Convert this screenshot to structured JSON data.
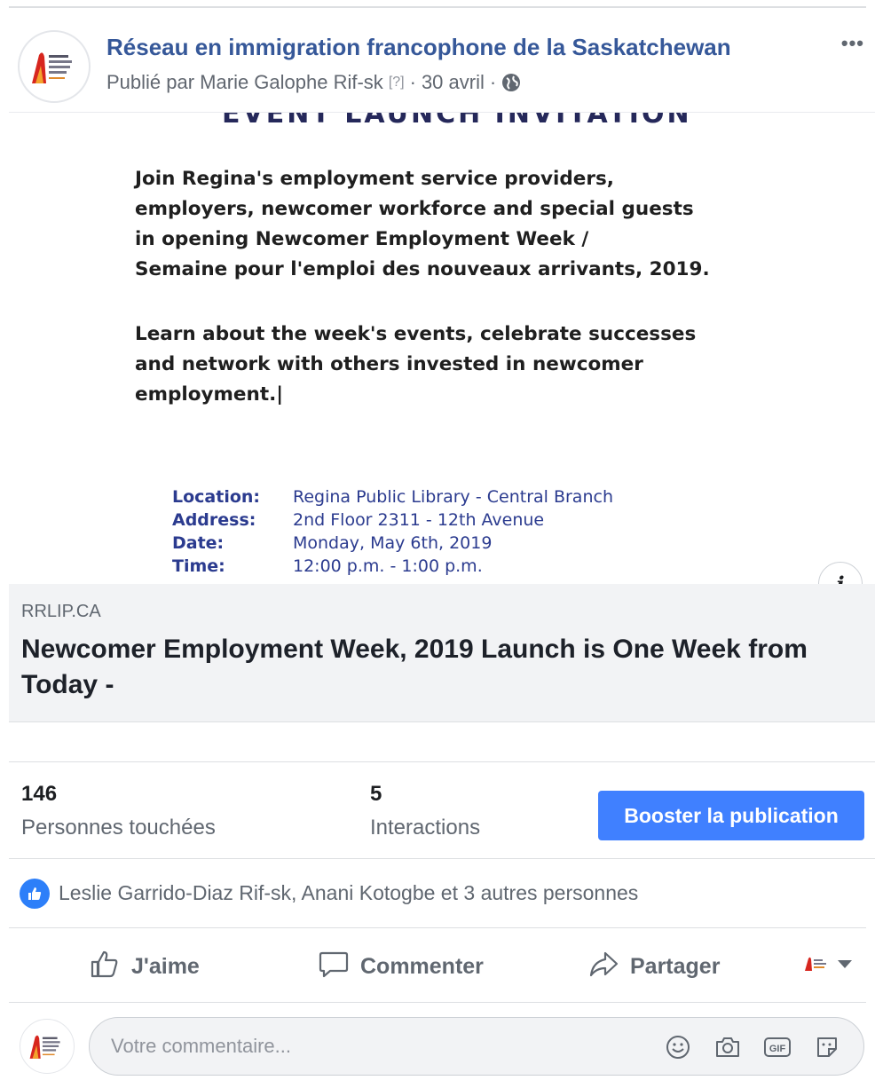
{
  "colors": {
    "link_blue": "#365899",
    "boost_blue": "#4080ff",
    "like_blue": "#2d7ff9",
    "muted_text": "#606770",
    "border": "#dddfe2",
    "preview_bg": "#f2f3f5"
  },
  "post": {
    "page_name": "Réseau en immigration francophone de la Saskatchewan",
    "published_by": "Publié par Marie Galophe Rif-sk",
    "help_marker": "[?]",
    "separator": "·",
    "date": "30 avril",
    "audience_icon": "globe-icon",
    "more_icon": "more-dots-icon",
    "more_label": "•••"
  },
  "image": {
    "heading": "EVENT LAUNCH INVITATION",
    "paragraph1": "Join Regina's employment service providers,\nemployers, newcomer workforce and special guests\nin opening Newcomer Employment Week /\nSemaine pour l'emploi des nouveaux arrivants, 2019.",
    "paragraph2": "Learn about the week's events, celebrate successes\nand network with others invested in newcomer\nemployment.|",
    "details": [
      {
        "label": "Location:",
        "value": "Regina Public Library - Central Branch"
      },
      {
        "label": "Address:",
        "value": "2nd Floor 2311 - 12th Avenue"
      },
      {
        "label": "Date:",
        "value": "Monday, May 6th, 2019"
      },
      {
        "label": "Time:",
        "value": "12:00 p.m. - 1:00 p.m."
      }
    ],
    "info_label": "i"
  },
  "link_preview": {
    "domain": "RRLIP.CA",
    "title": "Newcomer Employment Week, 2019 Launch is One Week from Today -"
  },
  "insights": {
    "reach_value": "146",
    "reach_label": "Personnes touchées",
    "engagement_value": "5",
    "engagement_label": "Interactions",
    "boost_label": "Booster la publication"
  },
  "reactions": {
    "icon": "like-icon",
    "text": "Leslie Garrido-Diaz Rif-sk, Anani Kotogbe et 3 autres personnes"
  },
  "actions": {
    "like_label": "J'aime",
    "comment_label": "Commenter",
    "share_label": "Partager"
  },
  "comment_box": {
    "placeholder": "Votre commentaire...",
    "icons": [
      "emoji-icon",
      "camera-icon",
      "gif-icon",
      "sticker-icon"
    ],
    "gif_label": "GIF"
  }
}
